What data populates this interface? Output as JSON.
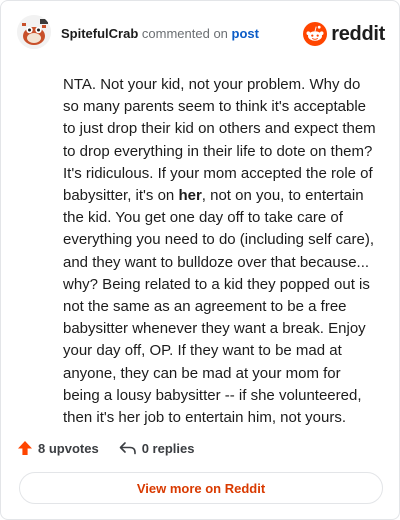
{
  "header": {
    "username": "SpitefulCrab",
    "verb": "commented on",
    "post_link": "post",
    "brand": "reddit"
  },
  "comment": {
    "before_bold": "NTA. Not your kid, not your problem. Why do so many parents seem to think it's acceptable to just drop their kid on others and expect them to drop everything in their life to dote on them? It's ridiculous. If your mom accepted the role of babysitter, it's on ",
    "bold": "her",
    "after_bold": ", not on you, to entertain the kid. You get one day off to take care of everything you need to do (including self care), and they want to bulldoze over that because... why? Being related to a kid they popped out is not the same as an agreement to be a free babysitter whenever they want a break. Enjoy your day off, OP. If they want to be mad at anyone, they can be mad at your mom for being a lousy babysitter -- if she volunteered, then it's her job to entertain him, not yours."
  },
  "actions": {
    "upvotes": "8 upvotes",
    "replies": "0 replies"
  },
  "footer": {
    "view_more": "View more on Reddit"
  },
  "colors": {
    "accent": "#d93a00",
    "upvote": "#ff4500",
    "link": "#0b5cc7"
  }
}
